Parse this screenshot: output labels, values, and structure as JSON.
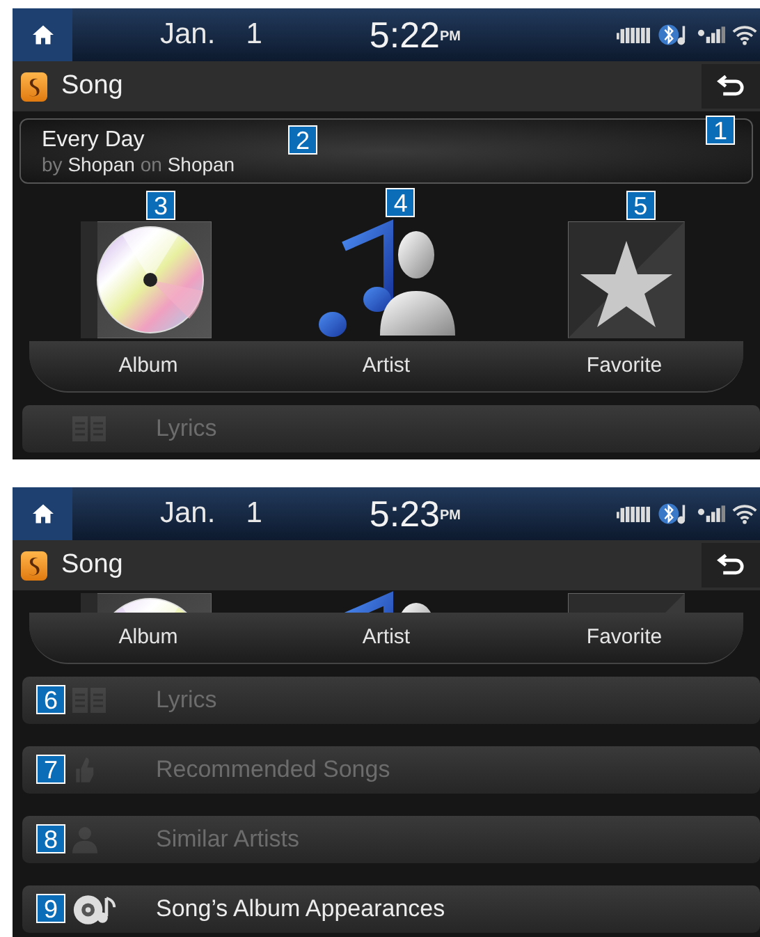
{
  "screens": [
    {
      "status_bar": {
        "month": "Jan.",
        "day": "1",
        "time": "5:22",
        "meridiem": "PM"
      },
      "title_bar": {
        "title": "Song",
        "back_callout": "1"
      },
      "now_playing": {
        "title": "Every Day",
        "subtitle": "by **Shopan** on **Shopan**",
        "callout": "2"
      },
      "scrolled": false,
      "categories": [
        {
          "kind": "album",
          "label": "Album",
          "callout": "3"
        },
        {
          "kind": "artist",
          "label": "Artist",
          "callout": "4"
        },
        {
          "kind": "favorite",
          "label": "Favorite",
          "callout": "5"
        }
      ],
      "menu": [
        {
          "kind": "lyrics",
          "label": "Lyrics",
          "disabled": true
        }
      ]
    },
    {
      "status_bar": {
        "month": "Jan.",
        "day": "1",
        "time": "5:23",
        "meridiem": "PM"
      },
      "title_bar": {
        "title": "Song"
      },
      "scrolled": true,
      "categories": [
        {
          "kind": "album",
          "label": "Album"
        },
        {
          "kind": "artist",
          "label": "Artist"
        },
        {
          "kind": "favorite",
          "label": "Favorite"
        }
      ],
      "menu": [
        {
          "kind": "lyrics",
          "label": "Lyrics",
          "disabled": true,
          "callout": "6"
        },
        {
          "kind": "recommended",
          "label": "Recommended Songs",
          "disabled": true,
          "callout": "7"
        },
        {
          "kind": "similar",
          "label": "Similar Artists",
          "disabled": true,
          "callout": "8"
        },
        {
          "kind": "appearances",
          "label": "Song’s Album Appearances",
          "disabled": false,
          "callout": "9"
        }
      ]
    }
  ]
}
